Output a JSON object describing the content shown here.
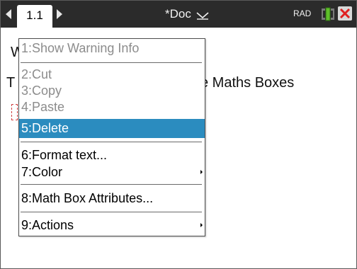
{
  "topbar": {
    "page_tab": "1.1",
    "doc_title": "*Doc",
    "angle_mode": "RAD",
    "icons": [
      "chevron-left-icon",
      "chevron-right-icon",
      "dropdown-icon",
      "battery-icon",
      "close-icon"
    ]
  },
  "document": {
    "line1_visible": "W",
    "line2_visible_start": "T",
    "line2_visible_end": "e Maths Boxes"
  },
  "context_menu": {
    "items": [
      {
        "label": "1:Show Warning Info",
        "enabled": false
      },
      {
        "label": "2:Cut",
        "enabled": false
      },
      {
        "label": "3:Copy",
        "enabled": false
      },
      {
        "label": "4:Paste",
        "enabled": false
      },
      {
        "label": "5:Delete",
        "enabled": true,
        "selected": true
      },
      {
        "label": "6:Format text...",
        "enabled": true
      },
      {
        "label": "7:Color",
        "enabled": true,
        "submenu": true
      },
      {
        "label": "8:Math Box Attributes...",
        "enabled": true
      },
      {
        "label": "9:Actions",
        "enabled": true,
        "submenu": true
      }
    ]
  },
  "colors": {
    "topbar_bg": "#2b2b2b",
    "selection": "#2b8cbf",
    "close_red": "#e02020",
    "battery_green": "#5fbf2a"
  }
}
